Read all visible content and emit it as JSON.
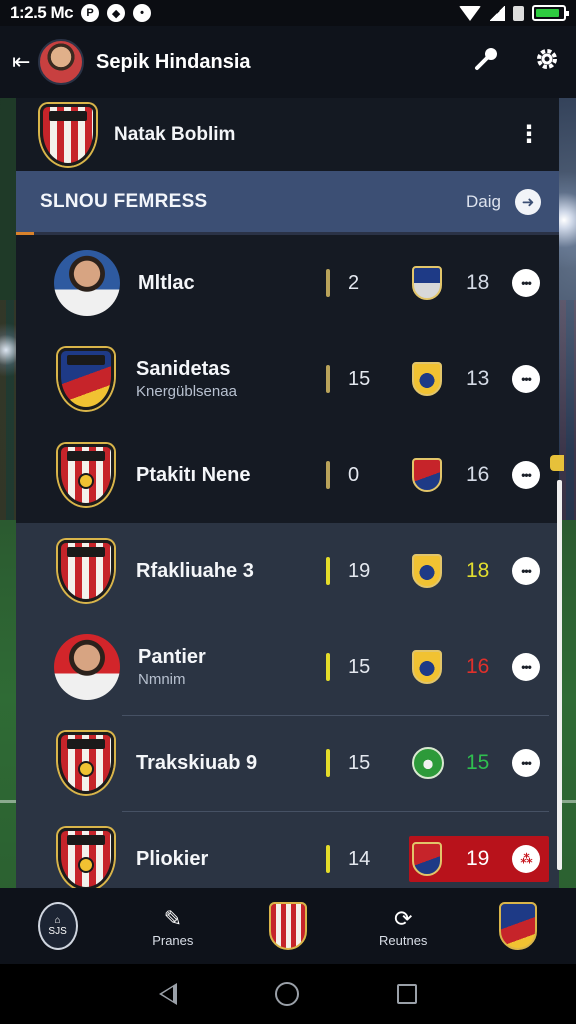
{
  "status_bar": {
    "time": "1:2.5 Mc",
    "icons": [
      "notification-p-icon",
      "notification-shield-icon",
      "notification-dot-icon"
    ],
    "battery_level": 0.9
  },
  "header": {
    "title": "Sepik Hindansia",
    "icons": [
      "back-icon",
      "avatar",
      "microphone-icon",
      "settings-icon"
    ]
  },
  "team_row": {
    "name": "Natak Boblim"
  },
  "section": {
    "title": "SLNOU FEMRESS",
    "sub": "Daig"
  },
  "rows": [
    {
      "name": "Mltlac",
      "sub": "",
      "stat1": "2",
      "stat2": "18",
      "stat2_color": "#d5dbe6",
      "avatar": "player-photo"
    },
    {
      "name": "Sanidetas",
      "sub": "Knergüblsenaa",
      "stat1": "15",
      "stat2": "13",
      "stat2_color": "#d5dbe6",
      "avatar": "crest"
    },
    {
      "name": "Ptakitı Nene",
      "sub": "",
      "stat1": "0",
      "stat2": "16",
      "stat2_color": "#d5dbe6",
      "avatar": "crest"
    },
    {
      "name": "Rfakliuahe 3",
      "sub": "",
      "stat1": "19",
      "stat2": "18",
      "stat2_color": "#e2de2f",
      "avatar": "crest"
    },
    {
      "name": "Pantier",
      "sub": "Nmnim",
      "stat1": "15",
      "stat2": "16",
      "stat2_color": "#e0302b",
      "avatar": "player-photo-red"
    },
    {
      "name": "Trakskiuab 9",
      "sub": "",
      "stat1": "15",
      "stat2": "15",
      "stat2_color": "#2fbf4f",
      "avatar": "crest"
    },
    {
      "name": "Pliokier",
      "sub": "",
      "stat1": "14",
      "stat2": "19",
      "stat2_color": "#ffffff",
      "avatar": "crest",
      "highlighted": true
    }
  ],
  "bottom_nav": {
    "home_label": "SJS",
    "items": [
      {
        "label": "",
        "icon": "home-badge-icon"
      },
      {
        "label": "Pranes",
        "icon": "pencil-square-icon"
      },
      {
        "label": "",
        "icon": "team-crest-icon"
      },
      {
        "label": "Reutnes",
        "icon": "refresh-icon"
      },
      {
        "label": "",
        "icon": "league-crest-icon"
      }
    ]
  },
  "colors": {
    "accent": "#3c4f74",
    "highlight": "#b8121b",
    "yellow": "#e2de2f",
    "red": "#e0302b",
    "green": "#2fbf4f"
  }
}
